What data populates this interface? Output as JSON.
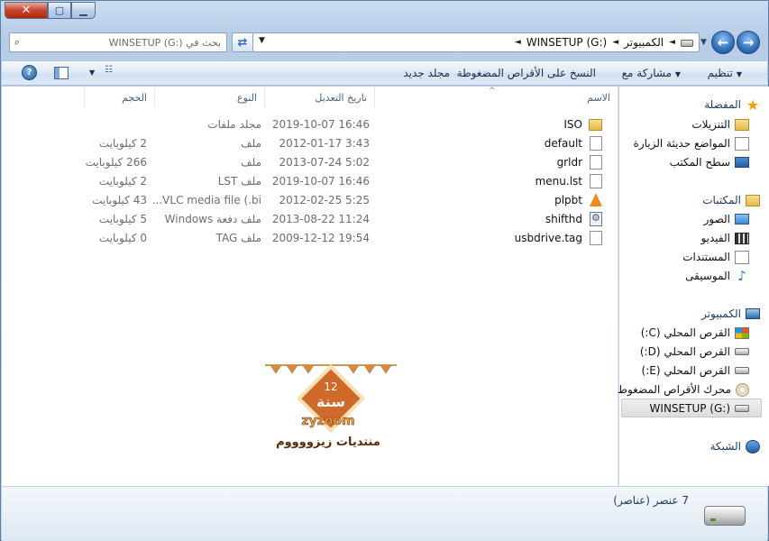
{
  "window": {
    "close_glyph": "✕",
    "maximize_glyph": "▢",
    "minimize_glyph": "▁"
  },
  "nav": {
    "back_glyph": "←",
    "forward_glyph": "→",
    "history_glyph": "▼"
  },
  "address": {
    "crumbs": [
      "الكمبيوتر",
      "WINSETUP (G:)"
    ],
    "separator": "◄",
    "dropdown_glyph": "▼"
  },
  "refresh_glyph": "⇄",
  "search": {
    "placeholder": "بحث في WINSETUP (G:)",
    "icon": "search-icon",
    "icon_glyph": "⌕"
  },
  "toolbar": {
    "organize": "تنظيم",
    "share_with": "مشاركة مع",
    "burn": "النسخ على الأقراص المضغوطة",
    "new_folder": "مجلد جديد",
    "help_glyph": "?",
    "dropdown_glyph": "▼",
    "views_glyph": "☷"
  },
  "columns": {
    "name": "الاسم",
    "date": "تاريخ التعديل",
    "type": "النوع",
    "size": "الحجم",
    "sort_glyph": "^"
  },
  "files": [
    {
      "name": "ISO",
      "date": "2019-10-07 16:46",
      "type": "مجلد ملفات",
      "size": "",
      "icon": "folder"
    },
    {
      "name": "default",
      "date": "2012-01-17 3:43",
      "type": "ملف",
      "size": "2 كيلوبايت",
      "icon": "file"
    },
    {
      "name": "grldr",
      "date": "2013-07-24 5:02",
      "type": "ملف",
      "size": "266 كيلوبايت",
      "icon": "file"
    },
    {
      "name": "menu.lst",
      "date": "2019-10-07 16:46",
      "type": "ملف LST",
      "size": "2 كيلوبايت",
      "icon": "file"
    },
    {
      "name": "plpbt",
      "date": "2012-02-25 5:25",
      "type": "VLC media file (.bi...",
      "size": "43 كيلوبايت",
      "icon": "vlc"
    },
    {
      "name": "shifthd",
      "date": "2013-08-22 11:24",
      "type": "ملف دفعة Windows",
      "size": "5 كيلوبايت",
      "icon": "batch"
    },
    {
      "name": "usbdrive.tag",
      "date": "2009-12-12 19:54",
      "type": "ملف TAG",
      "size": "0 كيلوبايت",
      "icon": "file"
    }
  ],
  "watermark": {
    "number": "12",
    "word": "سنة",
    "brand": "zyzoom",
    "caption": "منتديات زيزووووم"
  },
  "navpane": {
    "favorites": {
      "label": "المفضلة",
      "items": [
        "التنزيلات",
        "المواضع حديثة الزيارة",
        "سطح المكتب"
      ]
    },
    "libraries": {
      "label": "المكتبات",
      "items": [
        "الصور",
        "الفيديو",
        "المستندات",
        "الموسيقى"
      ]
    },
    "computer": {
      "label": "الكمبيوتر",
      "items": [
        "القرص المحلي (C:)",
        "القرص المحلي (D:)",
        "القرص المحلي (E:)",
        "محرك الأقراص المضغوط",
        "WINSETUP (G:)"
      ]
    },
    "network": {
      "label": "الشبكة"
    }
  },
  "details": {
    "count": "7 عنصر (عناصر)"
  }
}
